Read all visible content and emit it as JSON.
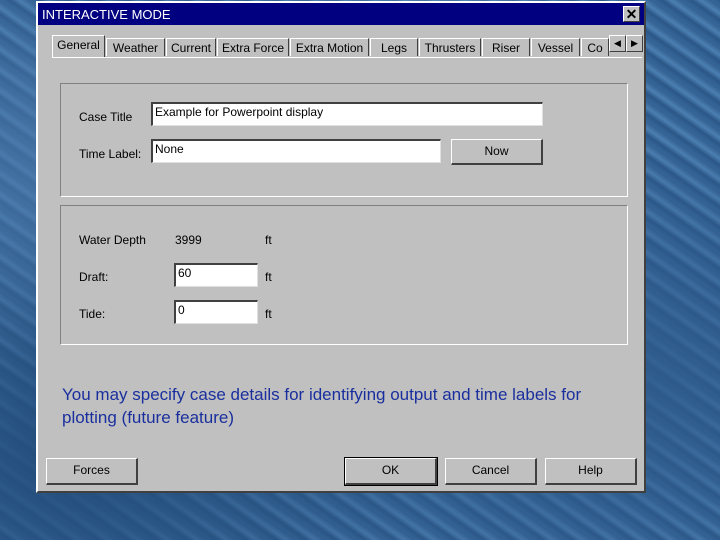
{
  "window": {
    "title": "INTERACTIVE MODE",
    "close_glyph": "✕"
  },
  "tabs": [
    {
      "label": "General",
      "active": true
    },
    {
      "label": "Weather"
    },
    {
      "label": "Current"
    },
    {
      "label": "Extra Force"
    },
    {
      "label": "Extra Motion"
    },
    {
      "label": "Legs"
    },
    {
      "label": "Thrusters"
    },
    {
      "label": "Riser"
    },
    {
      "label": "Vessel"
    },
    {
      "label": "Co"
    }
  ],
  "tab_arrows": {
    "left": "◀",
    "right": "▶"
  },
  "case": {
    "title_label": "Case Title",
    "title_value": "Example for Powerpoint display",
    "time_label": "Time Label:",
    "time_value": "None",
    "now_button": "Now"
  },
  "params": {
    "water_depth_label": "Water Depth",
    "water_depth_value": "3999",
    "water_depth_unit": "ft",
    "draft_label": "Draft:",
    "draft_value": "60",
    "draft_unit": "ft",
    "tide_label": "Tide:",
    "tide_value": "0",
    "tide_unit": "ft"
  },
  "info_text": "You may specify case details for identifying output and time labels for plotting (future feature)",
  "footer": {
    "forces": "Forces",
    "ok": "OK",
    "cancel": "Cancel",
    "help": "Help"
  }
}
